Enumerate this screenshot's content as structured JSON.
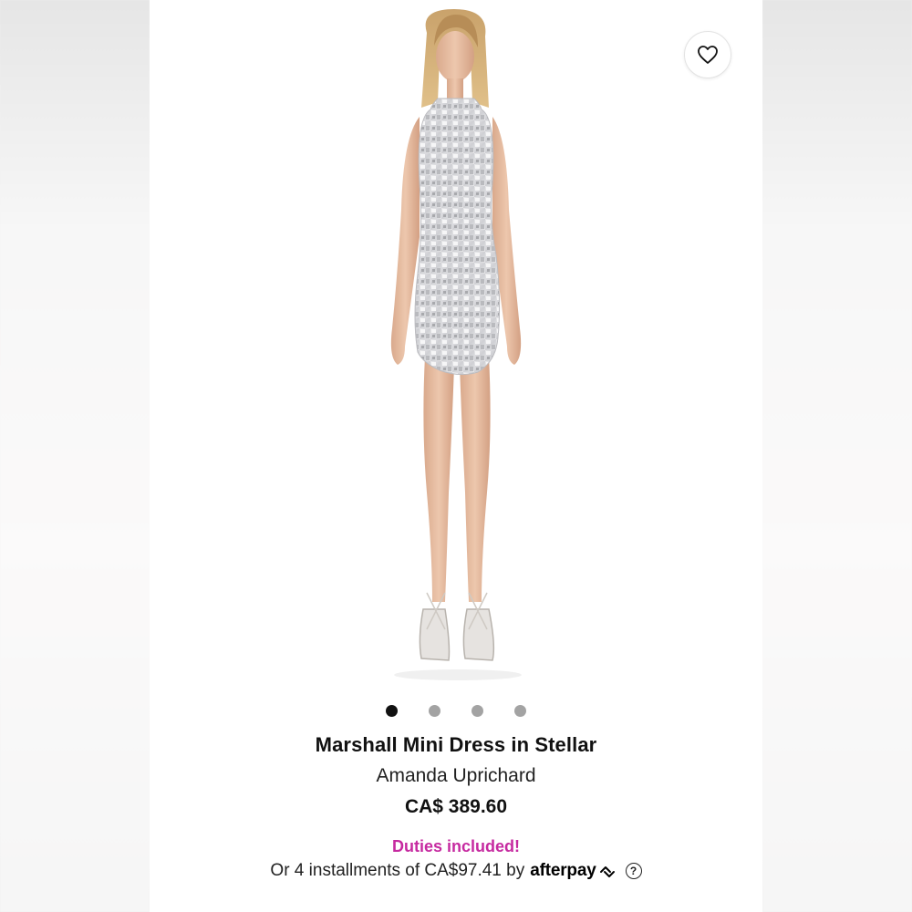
{
  "product": {
    "title": "Marshall Mini Dress in Stellar",
    "brand": "Amanda Uprichard",
    "price": "CA$ 389.60"
  },
  "gallery": {
    "image_count": 4,
    "active_index": 0,
    "wishlist_icon": "heart-outline-icon"
  },
  "promo": {
    "duties": "Duties included!",
    "installments_prefix": "Or 4 installments of CA$97.41 by",
    "afterpay_brand": "afterpay",
    "help_icon": "?"
  },
  "colors": {
    "duties_text": "#c62aa0",
    "active_dot": "#111111",
    "inactive_dot": "#a3a3a3"
  }
}
